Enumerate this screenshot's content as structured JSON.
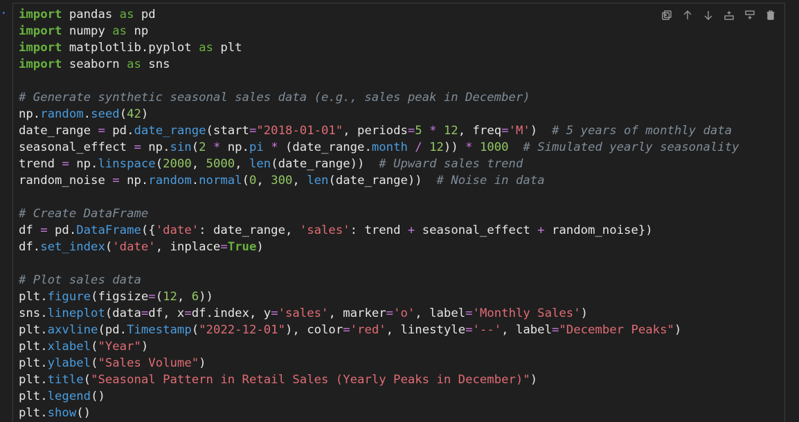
{
  "gutter": {
    "marker": "."
  },
  "toolbar": {
    "icons": [
      "copy-icon",
      "arrow-up-icon",
      "arrow-down-icon",
      "insert-above-icon",
      "insert-below-icon",
      "trash-icon"
    ]
  },
  "code": {
    "lines": [
      [
        [
          "kw",
          "import"
        ],
        [
          "pl",
          " pandas "
        ],
        [
          "as",
          "as"
        ],
        [
          "pl",
          " pd"
        ]
      ],
      [
        [
          "kw",
          "import"
        ],
        [
          "pl",
          " numpy "
        ],
        [
          "as",
          "as"
        ],
        [
          "pl",
          " np"
        ]
      ],
      [
        [
          "kw",
          "import"
        ],
        [
          "pl",
          " matplotlib.pyplot "
        ],
        [
          "as",
          "as"
        ],
        [
          "pl",
          " plt"
        ]
      ],
      [
        [
          "kw",
          "import"
        ],
        [
          "pl",
          " seaborn "
        ],
        [
          "as",
          "as"
        ],
        [
          "pl",
          " sns"
        ]
      ],
      [],
      [
        [
          "cm",
          "# Generate synthetic seasonal sales data (e.g., sales peak in December)"
        ]
      ],
      [
        [
          "pl",
          "np."
        ],
        [
          "fn",
          "random"
        ],
        [
          "pl",
          "."
        ],
        [
          "fn",
          "seed"
        ],
        [
          "pl",
          "("
        ],
        [
          "num",
          "42"
        ],
        [
          "pl",
          ")"
        ]
      ],
      [
        [
          "pl",
          "date_range "
        ],
        [
          "op",
          "="
        ],
        [
          "pl",
          " pd."
        ],
        [
          "fn",
          "date_range"
        ],
        [
          "pl",
          "(start"
        ],
        [
          "op",
          "="
        ],
        [
          "str",
          "\"2018-01-01\""
        ],
        [
          "pl",
          ", periods"
        ],
        [
          "op",
          "="
        ],
        [
          "num",
          "5"
        ],
        [
          "pl",
          " "
        ],
        [
          "op",
          "*"
        ],
        [
          "pl",
          " "
        ],
        [
          "num",
          "12"
        ],
        [
          "pl",
          ", freq"
        ],
        [
          "op",
          "="
        ],
        [
          "str",
          "'M'"
        ],
        [
          "pl",
          ")  "
        ],
        [
          "cm",
          "# 5 years of monthly data"
        ]
      ],
      [
        [
          "pl",
          "seasonal_effect "
        ],
        [
          "op",
          "="
        ],
        [
          "pl",
          " np."
        ],
        [
          "fn",
          "sin"
        ],
        [
          "pl",
          "("
        ],
        [
          "num",
          "2"
        ],
        [
          "pl",
          " "
        ],
        [
          "op",
          "*"
        ],
        [
          "pl",
          " np."
        ],
        [
          "fn",
          "pi"
        ],
        [
          "pl",
          " "
        ],
        [
          "op",
          "*"
        ],
        [
          "pl",
          " (date_range."
        ],
        [
          "fn",
          "month"
        ],
        [
          "pl",
          " "
        ],
        [
          "op",
          "/"
        ],
        [
          "pl",
          " "
        ],
        [
          "num",
          "12"
        ],
        [
          "pl",
          "))"
        ],
        [
          "pl",
          " "
        ],
        [
          "op",
          "*"
        ],
        [
          "pl",
          " "
        ],
        [
          "num",
          "1000"
        ],
        [
          "pl",
          "  "
        ],
        [
          "cm",
          "# Simulated yearly seasonality"
        ]
      ],
      [
        [
          "pl",
          "trend "
        ],
        [
          "op",
          "="
        ],
        [
          "pl",
          " np."
        ],
        [
          "fn",
          "linspace"
        ],
        [
          "pl",
          "("
        ],
        [
          "num",
          "2000"
        ],
        [
          "pl",
          ", "
        ],
        [
          "num",
          "5000"
        ],
        [
          "pl",
          ", "
        ],
        [
          "fn",
          "len"
        ],
        [
          "pl",
          "(date_range))  "
        ],
        [
          "cm",
          "# Upward sales trend"
        ]
      ],
      [
        [
          "pl",
          "random_noise "
        ],
        [
          "op",
          "="
        ],
        [
          "pl",
          " np."
        ],
        [
          "fn",
          "random"
        ],
        [
          "pl",
          "."
        ],
        [
          "fn",
          "normal"
        ],
        [
          "pl",
          "("
        ],
        [
          "num",
          "0"
        ],
        [
          "pl",
          ", "
        ],
        [
          "num",
          "300"
        ],
        [
          "pl",
          ", "
        ],
        [
          "fn",
          "len"
        ],
        [
          "pl",
          "(date_range))  "
        ],
        [
          "cm",
          "# Noise in data"
        ]
      ],
      [],
      [
        [
          "cm",
          "# Create DataFrame"
        ]
      ],
      [
        [
          "pl",
          "df "
        ],
        [
          "op",
          "="
        ],
        [
          "pl",
          " pd."
        ],
        [
          "fn",
          "DataFrame"
        ],
        [
          "pl",
          "({"
        ],
        [
          "str",
          "'date'"
        ],
        [
          "pl",
          ": date_range, "
        ],
        [
          "str",
          "'sales'"
        ],
        [
          "pl",
          ": trend "
        ],
        [
          "op",
          "+"
        ],
        [
          "pl",
          " seasonal_effect "
        ],
        [
          "op",
          "+"
        ],
        [
          "pl",
          " random_noise})"
        ]
      ],
      [
        [
          "pl",
          "df."
        ],
        [
          "fn",
          "set_index"
        ],
        [
          "pl",
          "("
        ],
        [
          "str",
          "'date'"
        ],
        [
          "pl",
          ", inplace"
        ],
        [
          "op",
          "="
        ],
        [
          "bool",
          "True"
        ],
        [
          "pl",
          ")"
        ]
      ],
      [],
      [
        [
          "cm",
          "# Plot sales data"
        ]
      ],
      [
        [
          "pl",
          "plt."
        ],
        [
          "fn",
          "figure"
        ],
        [
          "pl",
          "(figsize"
        ],
        [
          "op",
          "="
        ],
        [
          "pl",
          "("
        ],
        [
          "num",
          "12"
        ],
        [
          "pl",
          ", "
        ],
        [
          "num",
          "6"
        ],
        [
          "pl",
          "))"
        ]
      ],
      [
        [
          "pl",
          "sns."
        ],
        [
          "fn",
          "lineplot"
        ],
        [
          "pl",
          "(data"
        ],
        [
          "op",
          "="
        ],
        [
          "pl",
          "df, x"
        ],
        [
          "op",
          "="
        ],
        [
          "pl",
          "df.index, y"
        ],
        [
          "op",
          "="
        ],
        [
          "str",
          "'sales'"
        ],
        [
          "pl",
          ", marker"
        ],
        [
          "op",
          "="
        ],
        [
          "str",
          "'o'"
        ],
        [
          "pl",
          ", label"
        ],
        [
          "op",
          "="
        ],
        [
          "str",
          "'Monthly Sales'"
        ],
        [
          "pl",
          ")"
        ]
      ],
      [
        [
          "pl",
          "plt."
        ],
        [
          "fn",
          "axvline"
        ],
        [
          "pl",
          "(pd."
        ],
        [
          "fn",
          "Timestamp"
        ],
        [
          "pl",
          "("
        ],
        [
          "str",
          "\"2022-12-01\""
        ],
        [
          "pl",
          "), color"
        ],
        [
          "op",
          "="
        ],
        [
          "str",
          "'red'"
        ],
        [
          "pl",
          ", linestyle"
        ],
        [
          "op",
          "="
        ],
        [
          "str",
          "'--'"
        ],
        [
          "pl",
          ", label"
        ],
        [
          "op",
          "="
        ],
        [
          "str",
          "\"December Peaks\""
        ],
        [
          "pl",
          ")"
        ]
      ],
      [
        [
          "pl",
          "plt."
        ],
        [
          "fn",
          "xlabel"
        ],
        [
          "pl",
          "("
        ],
        [
          "str",
          "\"Year\""
        ],
        [
          "pl",
          ")"
        ]
      ],
      [
        [
          "pl",
          "plt."
        ],
        [
          "fn",
          "ylabel"
        ],
        [
          "pl",
          "("
        ],
        [
          "str",
          "\"Sales Volume\""
        ],
        [
          "pl",
          ")"
        ]
      ],
      [
        [
          "pl",
          "plt."
        ],
        [
          "fn",
          "title"
        ],
        [
          "pl",
          "("
        ],
        [
          "str",
          "\"Seasonal Pattern in Retail Sales (Yearly Peaks in December)\""
        ],
        [
          "pl",
          ")"
        ]
      ],
      [
        [
          "pl",
          "plt."
        ],
        [
          "fn",
          "legend"
        ],
        [
          "pl",
          "()"
        ]
      ],
      [
        [
          "pl",
          "plt."
        ],
        [
          "fn",
          "show"
        ],
        [
          "pl",
          "()"
        ]
      ]
    ]
  }
}
